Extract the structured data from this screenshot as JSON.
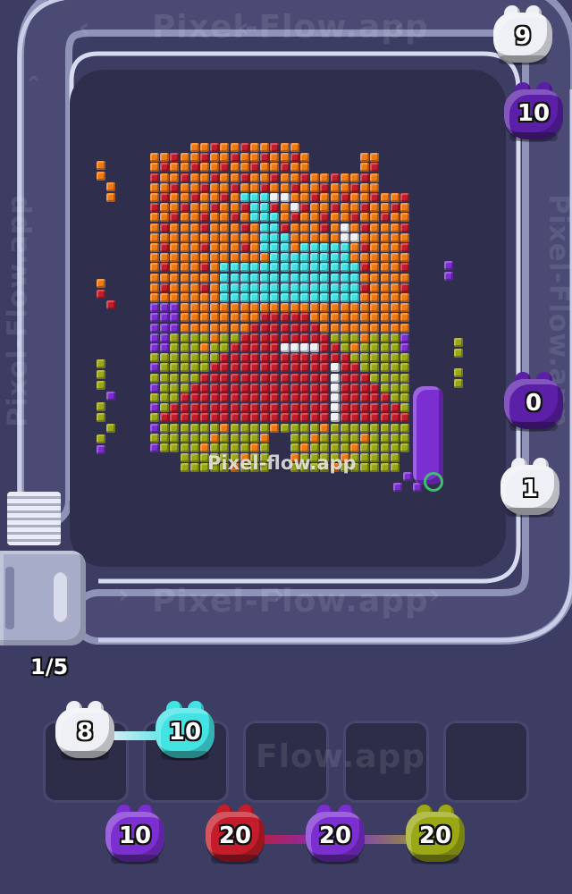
{
  "watermarks": {
    "top": "Pixel-Flow.app",
    "left": "Pixel-Flow.app",
    "right": "Pixel-Flow.app",
    "bottom": "Pixel-Flow.app",
    "slots": "Flow.app",
    "center": "Pixel-flow.app"
  },
  "level_progress": "1/5",
  "colors": {
    "background": "#3d3d63",
    "board": "#2f2e4d",
    "track": "#a9aed0",
    "white": "#eef0f6",
    "cyan": "#43e3e4",
    "purple": "#7b2fd1",
    "red": "#c41c2a",
    "orange": "#f07a12",
    "olive": "#9aa815",
    "dark_purple": "#5b1fa8"
  },
  "track_queue": [
    {
      "id": "q1",
      "color": "white",
      "count": "9"
    },
    {
      "id": "q2",
      "color": "dark_purple",
      "count": "10"
    },
    {
      "id": "q3",
      "color": "dark_purple",
      "count": "0"
    },
    {
      "id": "q4",
      "color": "white",
      "count": "1"
    }
  ],
  "holding_slots": [
    {
      "pig": {
        "color": "white",
        "count": "8"
      }
    },
    {
      "pig": {
        "color": "cyan",
        "count": "10"
      }
    },
    {
      "pig": null
    },
    {
      "pig": null
    },
    {
      "pig": null
    }
  ],
  "waiting_pigs": [
    {
      "color": "purple",
      "count": "10"
    },
    {
      "color": "red",
      "count": "20"
    },
    {
      "color": "purple",
      "count": "20"
    },
    {
      "color": "olive",
      "count": "20"
    }
  ]
}
